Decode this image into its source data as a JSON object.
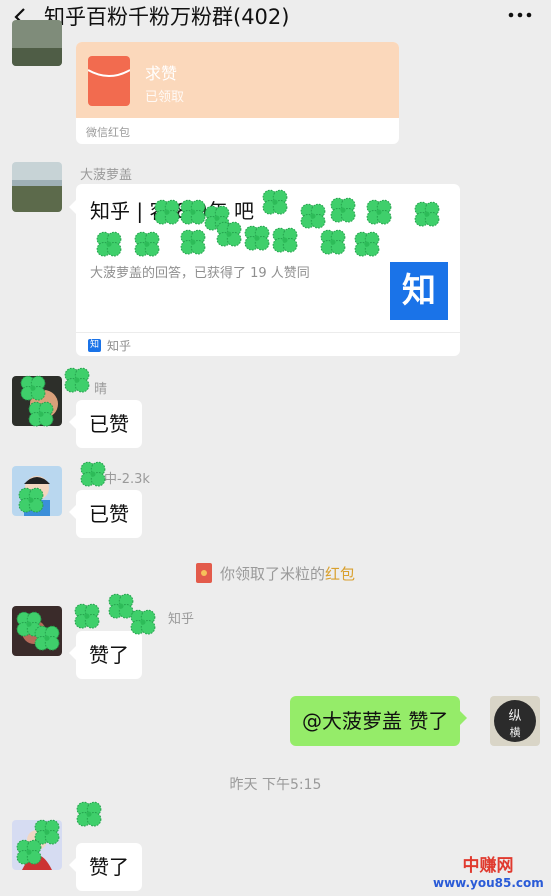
{
  "header": {
    "title": "知乎百粉千粉万粉群(402)",
    "back_icon": "chevron-left-icon",
    "more_icon": "more-dots-icon"
  },
  "red_packet": {
    "title": "求赞",
    "status": "已领取",
    "footer": "微信红包"
  },
  "messages": [
    {
      "sender": "大菠萝盖",
      "type": "link",
      "title_visible": "知乎 | 容 8 9年 吧",
      "description": "大菠萝盖的回答，已获得了 19 人赞同",
      "thumb_char": "知",
      "source": "知乎"
    },
    {
      "sender": "晴",
      "text": "已赞"
    },
    {
      "sender": "中-2.3k",
      "text": "已赞"
    },
    {
      "sender": "知乎",
      "text": "赞了"
    },
    {
      "sender": "",
      "text": "@大菠萝盖  赞了",
      "side": "right"
    },
    {
      "sender": "",
      "text": "赞了"
    }
  ],
  "system": {
    "prefix": "你领取了米粒的",
    "highlight": "红包"
  },
  "timestamp": "昨天 下午5:15",
  "watermark": {
    "main": "中赚网",
    "url": "www.you85.com"
  },
  "colors": {
    "background": "#ededed",
    "bubble_self": "#95ec69",
    "red_packet": "#fbd8bb",
    "highlight": "#d9a02e",
    "zhihu_blue": "#1a73e8",
    "clover": "#3fcf6b"
  }
}
